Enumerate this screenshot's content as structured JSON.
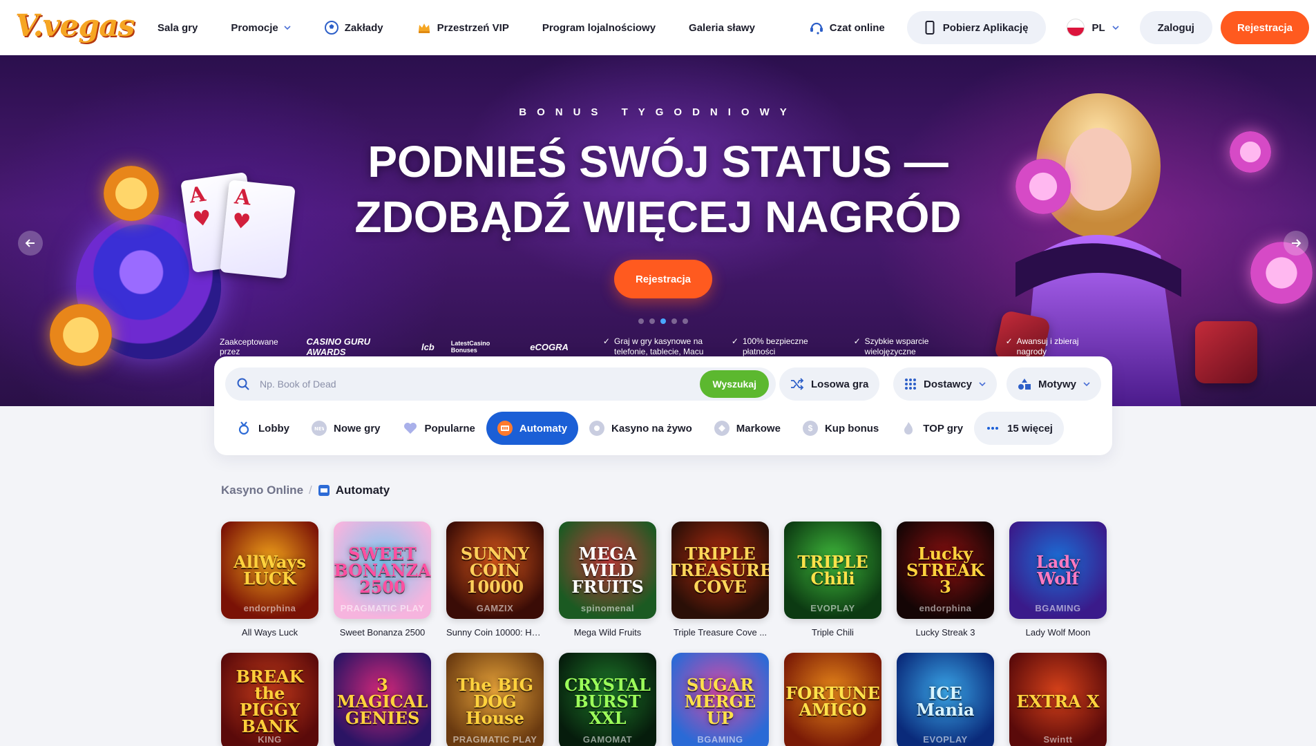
{
  "header": {
    "logo": "V.vegas",
    "nav": [
      {
        "label": "Sala gry",
        "icon": ""
      },
      {
        "label": "Promocje",
        "icon": "chevron-down-icon"
      },
      {
        "label": "Zakłady",
        "icon": "soccer-ball-icon"
      },
      {
        "label": "Przestrzeń VIP",
        "icon": "crown-icon"
      },
      {
        "label": "Program lojalnościowy",
        "icon": ""
      },
      {
        "label": "Galeria sławy",
        "icon": ""
      }
    ],
    "chat": "Czat online",
    "app": "Pobierz Aplikację",
    "lang": "PL",
    "login": "Zaloguj",
    "register": "Rejestracja"
  },
  "hero": {
    "subtitle": "BONUS TYGODNIOWY",
    "title_line1": "PODNIEŚ SWÓJ STATUS —",
    "title_line2": "ZDOBĄDŹ WIĘCEJ NAGRÓD",
    "cta": "Rejestracja",
    "slides_total": 5,
    "slide_active": 3,
    "trust": {
      "accepted": "Zaakceptowane przez",
      "badges": [
        "CASINO GURU AWARDS",
        "lcb",
        "LatestCasino Bonuses",
        "eCOGRA"
      ],
      "features": [
        "Graj w gry kasynowe na telefonie, tablecie, Macu",
        "100% bezpieczne płatności",
        "Szybkie wsparcie wielojęzyczne",
        "Awansuj i zbieraj nagrody"
      ]
    },
    "card_letters": [
      "A",
      "A"
    ]
  },
  "search": {
    "placeholder": "Np. Book of Dead",
    "button": "Wyszukaj",
    "random": "Losowa gra",
    "providers": "Dostawcy",
    "themes": "Motywy"
  },
  "categories": [
    {
      "label": "Lobby",
      "icon": "trophy-icon",
      "color": "#2d6bd6",
      "active": false
    },
    {
      "label": "Nowe gry",
      "icon": "new-badge-icon",
      "color": "#8f95b5",
      "active": false
    },
    {
      "label": "Popularne",
      "icon": "heart-icon",
      "color": "#8f95e0",
      "active": false
    },
    {
      "label": "Automaty",
      "icon": "slot-machine-icon",
      "color": "#ff7a2e",
      "active": true
    },
    {
      "label": "Kasyno na żywo",
      "icon": "live-casino-icon",
      "color": "#8f95b5",
      "active": false
    },
    {
      "label": "Markowe",
      "icon": "brand-icon",
      "color": "#8f95b5",
      "active": false
    },
    {
      "label": "Kup bonus",
      "icon": "dollar-coin-icon",
      "color": "#8f95b5",
      "active": false
    },
    {
      "label": "TOP gry",
      "icon": "flame-icon",
      "color": "#8f95b5",
      "active": false
    },
    {
      "label": "15 więcej",
      "icon": "more-dots-icon",
      "color": "#1b5fd6",
      "active": false
    }
  ],
  "breadcrumb": {
    "root": "Kasyno Online",
    "current": "Automaty"
  },
  "games": [
    {
      "name": "All Ways Luck",
      "art": "AllWays LUCK",
      "provider": "endorphina",
      "bg1": "#7a1206",
      "bg2": "#f0a21a",
      "fg": "#ffd23d"
    },
    {
      "name": "Sweet Bonanza 2500",
      "art": "SWEET BONANZA 2500",
      "provider": "PRAGMATIC PLAY",
      "bg1": "#f6b4de",
      "bg2": "#7ec8f2",
      "fg": "#ff4fa0"
    },
    {
      "name": "Sunny Coin 10000: Hol...",
      "art": "SUNNY COIN 10000",
      "provider": "GAMZIX",
      "bg1": "#3a0c06",
      "bg2": "#d9581c",
      "fg": "#ffcf5a"
    },
    {
      "name": "Mega Wild Fruits",
      "art": "MEGA WILD FRUITS",
      "provider": "spinomenal",
      "bg1": "#1b5a22",
      "bg2": "#c33b3b",
      "fg": "#ffffff"
    },
    {
      "name": "Triple Treasure Cove ...",
      "art": "TRIPLE TREASURE COVE",
      "provider": "",
      "bg1": "#2a0f07",
      "bg2": "#b32c10",
      "fg": "#ffd659"
    },
    {
      "name": "Triple Chili",
      "art": "TRIPLE Chili",
      "provider": "EVOPLAY",
      "bg1": "#0c3a12",
      "bg2": "#3fb83b",
      "fg": "#ffe24a"
    },
    {
      "name": "Lucky Streak 3",
      "art": "Lucky STREAK 3",
      "provider": "endorphina",
      "bg1": "#140505",
      "bg2": "#8a1010",
      "fg": "#ffd23d"
    },
    {
      "name": "Lady Wolf Moon",
      "art": "Lady Wolf",
      "provider": "BGAMING",
      "bg1": "#3a1a8a",
      "bg2": "#1b6fd6",
      "fg": "#ff7ac2"
    },
    {
      "name": "",
      "art": "BREAK the PIGGY BANK",
      "provider": "KING",
      "bg1": "#5a0a0a",
      "bg2": "#c23a1a",
      "fg": "#ffcf3a"
    },
    {
      "name": "",
      "art": "3 MAGICAL GENIES",
      "provider": "",
      "bg1": "#2b1464",
      "bg2": "#d4287a",
      "fg": "#ffd23d"
    },
    {
      "name": "",
      "art": "The BIG DOG House",
      "provider": "PRAGMATIC PLAY",
      "bg1": "#6a3a10",
      "bg2": "#e8a43a",
      "fg": "#ffd23d"
    },
    {
      "name": "",
      "art": "CRYSTAL BURST XXL",
      "provider": "GAMOMAT",
      "bg1": "#061c0c",
      "bg2": "#1f7a2a",
      "fg": "#9cff5a"
    },
    {
      "name": "",
      "art": "SUGAR MERGE UP",
      "provider": "BGAMING",
      "bg1": "#2a6ad6",
      "bg2": "#d64aa6",
      "fg": "#ffe14a"
    },
    {
      "name": "",
      "art": "FORTUNE AMIGO",
      "provider": "",
      "bg1": "#7a1a06",
      "bg2": "#e8881a",
      "fg": "#ffe14a"
    },
    {
      "name": "",
      "art": "ICE Mania",
      "provider": "EVOPLAY",
      "bg1": "#0a2a7a",
      "bg2": "#3aa6e8",
      "fg": "#d8f4ff"
    },
    {
      "name": "",
      "art": "EXTRA X",
      "provider": "Swintt",
      "bg1": "#5a0a0a",
      "bg2": "#d6421a",
      "fg": "#ffd23d"
    }
  ],
  "colors": {
    "accent_orange": "#ff5a1f",
    "active_blue": "#1b5fd6",
    "search_green": "#5cb82f"
  }
}
